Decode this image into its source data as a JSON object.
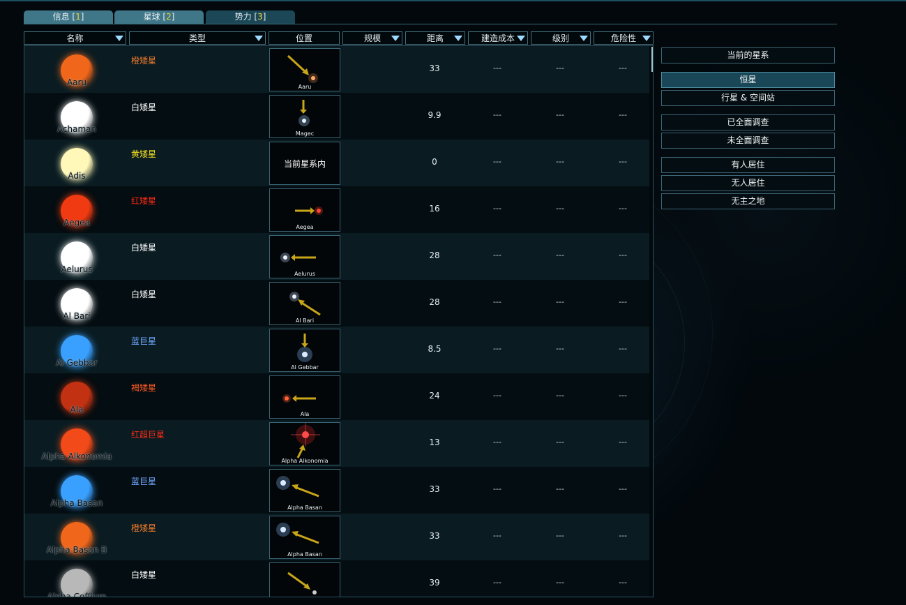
{
  "tabs": [
    {
      "label": "信息 [",
      "num": "1",
      "end": "]"
    },
    {
      "label": "星球 [",
      "num": "2",
      "end": "]"
    },
    {
      "label": "势力 [",
      "num": "3",
      "end": "]"
    }
  ],
  "columns": [
    "名称",
    "类型",
    "位置",
    "规模",
    "距离",
    "建造成本",
    "级别",
    "危险性"
  ],
  "rows": [
    {
      "name": "Aaru",
      "type": "橙矮星",
      "type_color": "#f07a2a",
      "star_color": "#f0671c",
      "pos": "Aaru",
      "dist": "33",
      "cost": "---",
      "level": "---",
      "danger": "---"
    },
    {
      "name": "Achaman",
      "type": "白矮星",
      "type_color": "#ffffff",
      "star_color": "#ffffff",
      "pos": "Magec",
      "dist": "9.9",
      "cost": "---",
      "level": "---",
      "danger": "---"
    },
    {
      "name": "Adis",
      "type": "黄矮星",
      "type_color": "#f5e020",
      "star_color": "#fff8b8",
      "pos": "当前星系内",
      "dist": "0",
      "cost": "---",
      "level": "---",
      "danger": "---"
    },
    {
      "name": "Aegea",
      "type": "红矮星",
      "type_color": "#ff2a14",
      "star_color": "#f03a12",
      "pos": "Aegea",
      "dist": "16",
      "cost": "---",
      "level": "---",
      "danger": "---"
    },
    {
      "name": "Aelurus",
      "type": "白矮星",
      "type_color": "#ffffff",
      "star_color": "#ffffff",
      "pos": "Aelurus",
      "dist": "28",
      "cost": "---",
      "level": "---",
      "danger": "---"
    },
    {
      "name": "Al Bari",
      "type": "白矮星",
      "type_color": "#ffffff",
      "star_color": "#ffffff",
      "pos": "Al Bari",
      "dist": "28",
      "cost": "---",
      "level": "---",
      "danger": "---"
    },
    {
      "name": "Al Gebbar",
      "type": "蓝巨星",
      "type_color": "#6fa8ff",
      "star_color": "#3aa0ff",
      "pos": "Al Gebbar",
      "dist": "8.5",
      "cost": "---",
      "level": "---",
      "danger": "---"
    },
    {
      "name": "Ala",
      "type": "褐矮星",
      "type_color": "#ff5a22",
      "star_color": "#c23212",
      "pos": "Ala",
      "dist": "24",
      "cost": "---",
      "level": "---",
      "danger": "---"
    },
    {
      "name": "Alpha Alkonomia",
      "type": "红超巨星",
      "type_color": "#ff2a14",
      "star_color": "#f24a18",
      "pos": "Alpha Alkonomia",
      "dist": "13",
      "cost": "---",
      "level": "---",
      "danger": "---"
    },
    {
      "name": "Alpha Basan",
      "type": "蓝巨星",
      "type_color": "#6fa8ff",
      "star_color": "#3aa0ff",
      "pos": "Alpha Basan",
      "dist": "33",
      "cost": "---",
      "level": "---",
      "danger": "---"
    },
    {
      "name": "Alpha Basan B",
      "type": "橙矮星",
      "type_color": "#f07a2a",
      "star_color": "#f0671c",
      "pos": "Alpha Basan",
      "dist": "33",
      "cost": "---",
      "level": "---",
      "danger": "---"
    },
    {
      "name": "Alpha Coffium",
      "type": "白矮星",
      "type_color": "#ffffff",
      "star_color": "#b8b8b8",
      "pos": "",
      "dist": "39",
      "cost": "---",
      "level": "---",
      "danger": "---"
    }
  ],
  "filters": [
    {
      "label": "当前的星系",
      "active": false
    },
    {
      "label": "恒星",
      "active": true
    },
    {
      "label": "行星 & 空间站",
      "active": false
    },
    {
      "label": "已全面调查",
      "active": false
    },
    {
      "label": "未全面调查",
      "active": false
    },
    {
      "label": "有人居住",
      "active": false
    },
    {
      "label": "无人居住",
      "active": false
    },
    {
      "label": "无主之地",
      "active": false
    }
  ]
}
